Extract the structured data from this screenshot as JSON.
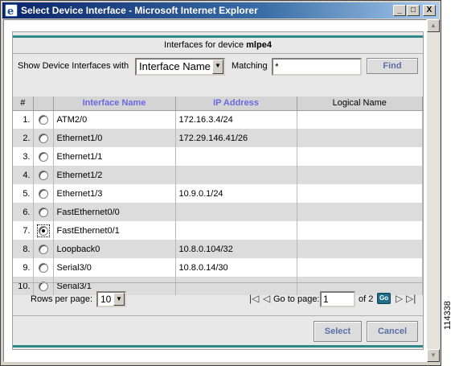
{
  "window": {
    "title": "Select Device Interface - Microsoft Internet Explorer",
    "minimize": "_",
    "maximize": "□",
    "close": "X"
  },
  "header": {
    "title_prefix": "Interfaces for device",
    "device": "mlpe4"
  },
  "filter": {
    "show_label": "Show Device Interfaces with",
    "field_value": "Interface Name",
    "matching_label": "Matching",
    "matching_value": "*",
    "find_label": "Find"
  },
  "table": {
    "columns": [
      "#",
      "",
      "Interface Name",
      "IP Address",
      "Logical Name"
    ],
    "rows": [
      {
        "num": "1.",
        "name": "ATM2/0",
        "ip": "172.16.3.4/24",
        "logical": "",
        "selected": false
      },
      {
        "num": "2.",
        "name": "Ethernet1/0",
        "ip": "172.29.146.41/26",
        "logical": "",
        "selected": false
      },
      {
        "num": "3.",
        "name": "Ethernet1/1",
        "ip": "",
        "logical": "",
        "selected": false
      },
      {
        "num": "4.",
        "name": "Ethernet1/2",
        "ip": "",
        "logical": "",
        "selected": false
      },
      {
        "num": "5.",
        "name": "Ethernet1/3",
        "ip": "10.9.0.1/24",
        "logical": "",
        "selected": false
      },
      {
        "num": "6.",
        "name": "FastEthernet0/0",
        "ip": "",
        "logical": "",
        "selected": false
      },
      {
        "num": "7.",
        "name": "FastEthernet0/1",
        "ip": "",
        "logical": "",
        "selected": true
      },
      {
        "num": "8.",
        "name": "Loopback0",
        "ip": "10.8.0.104/32",
        "logical": "",
        "selected": false
      },
      {
        "num": "9.",
        "name": "Serial3/0",
        "ip": "10.8.0.14/30",
        "logical": "",
        "selected": false
      },
      {
        "num": "10.",
        "name": "Serial3/1",
        "ip": "",
        "logical": "",
        "selected": false
      }
    ]
  },
  "pager": {
    "rows_per_page_label": "Rows per page:",
    "rows_per_page_value": "10",
    "goto_label": "Go to page:",
    "page_value": "1",
    "of_label": "of 2",
    "go_label": "Go"
  },
  "actions": {
    "select_label": "Select",
    "cancel_label": "Cancel"
  },
  "side_label": "114338",
  "colors": {
    "titlebar": "#0a246a",
    "accent_line": "#2f8a89",
    "header_link": "#6a6ae0",
    "button_text": "#5b6fa8"
  }
}
